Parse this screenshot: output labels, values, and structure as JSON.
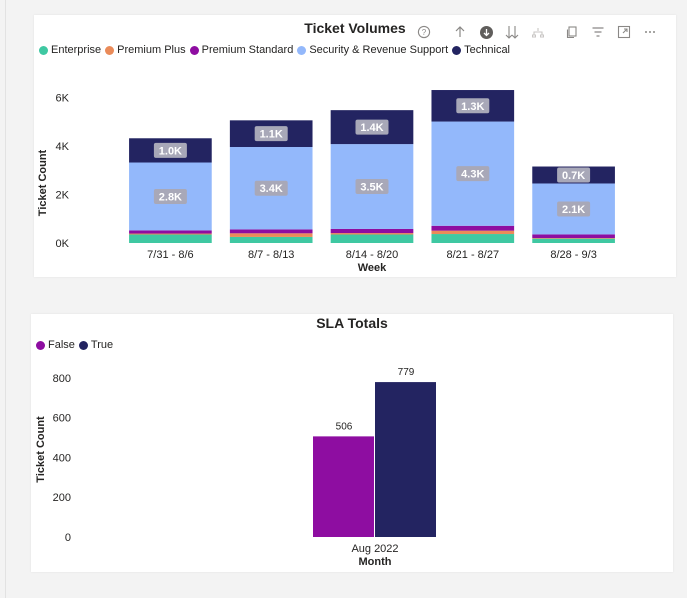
{
  "colors": {
    "enterprise": "#3fc8a2",
    "premium_plus": "#ea8b59",
    "premium_standard": "#8e0da1",
    "security_revenue": "#93b8fb",
    "technical": "#232461",
    "false": "#8e0da1",
    "true": "#232461",
    "label_pill": "#a8a8b8"
  },
  "toolbar_icons": [
    "help-icon",
    "arrow-up-icon",
    "drill-down-icon",
    "expand-all-icon",
    "hierarchy-icon",
    "copy-icon",
    "filter-icon",
    "focus-mode-icon",
    "more-options-icon"
  ],
  "chart_data": [
    {
      "type": "bar",
      "stacked": true,
      "title": "Ticket Volumes",
      "xlabel": "Week",
      "ylabel": "Ticket Count",
      "categories": [
        "7/31 - 8/6",
        "8/7 - 8/13",
        "8/14 - 8/20",
        "8/21 - 8/27",
        "8/28 - 9/3"
      ],
      "ylim": [
        0,
        6600
      ],
      "yticks": [
        0,
        2000,
        4000,
        6000
      ],
      "ytick_labels": [
        "0K",
        "2K",
        "4K",
        "6K"
      ],
      "legend_position": "top-left",
      "series": [
        {
          "name": "Enterprise",
          "color_key": "enterprise",
          "values": [
            350,
            250,
            350,
            370,
            180
          ]
        },
        {
          "name": "Premium Plus",
          "color_key": "premium_plus",
          "values": [
            40,
            150,
            60,
            140,
            25
          ]
        },
        {
          "name": "Premium Standard",
          "color_key": "premium_standard",
          "values": [
            130,
            160,
            170,
            200,
            150
          ]
        },
        {
          "name": "Security & Revenue Support",
          "color_key": "security_revenue",
          "values": [
            2800,
            3400,
            3500,
            4300,
            2100
          ],
          "labels": [
            "2.8K",
            "3.4K",
            "3.5K",
            "4.3K",
            "2.1K"
          ]
        },
        {
          "name": "Technical",
          "color_key": "technical",
          "values": [
            1000,
            1100,
            1400,
            1300,
            700
          ],
          "labels": [
            "1.0K",
            "1.1K",
            "1.4K",
            "1.3K",
            "0.7K"
          ]
        }
      ]
    },
    {
      "type": "bar",
      "title": "SLA Totals",
      "xlabel": "Month",
      "ylabel": "Ticket Count",
      "categories": [
        "Aug 2022"
      ],
      "ylim": [
        0,
        880
      ],
      "yticks": [
        0,
        200,
        400,
        600,
        800
      ],
      "ytick_labels": [
        "0",
        "200",
        "400",
        "600",
        "800"
      ],
      "legend_position": "top-left",
      "series": [
        {
          "name": "False",
          "color_key": "false",
          "values": [
            506
          ],
          "labels": [
            "506"
          ]
        },
        {
          "name": "True",
          "color_key": "true",
          "values": [
            779
          ],
          "labels": [
            "779"
          ]
        }
      ]
    }
  ]
}
